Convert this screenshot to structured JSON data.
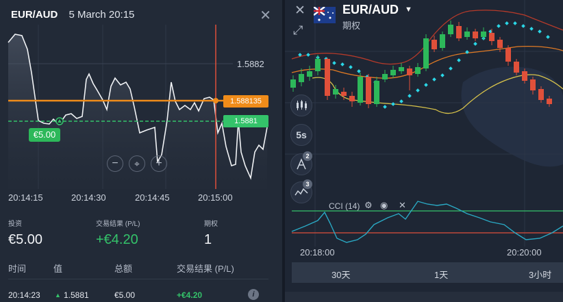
{
  "left_panel": {
    "asset": "EUR/AUD",
    "datetime": "5 March 20:15",
    "close_icon": "close-icon",
    "price_levels": {
      "top_label": "1.5882",
      "entry_price": "1.588135",
      "current_price": "1.5881"
    },
    "stake_marker": "€5.00",
    "x_axis": [
      "20:14:15",
      "20:14:30",
      "20:14:45",
      "20:15:00"
    ],
    "chart_controls": [
      "zoom-out-icon",
      "crosshair-icon",
      "zoom-in-icon"
    ],
    "info": {
      "investment_label": "投资",
      "investment_value": "€5.00",
      "pl_label": "交易结果 (P/L)",
      "pl_value": "+€4.20",
      "option_label": "期权",
      "option_value": "1"
    },
    "trades": {
      "headers": [
        "时间",
        "值",
        "总额",
        "交易结果 (P/L)"
      ],
      "rows": [
        {
          "time": "20:14:23",
          "value": "1.5881",
          "amount": "€5.00",
          "pl": "+€4.20"
        }
      ]
    }
  },
  "right_panel": {
    "asset": "EUR/AUD",
    "subtitle": "期权",
    "tools": [
      {
        "name": "chart-type-icon",
        "label": ""
      },
      {
        "name": "timeframe-button",
        "label": "5s"
      },
      {
        "name": "drawing-tools-icon",
        "label": "",
        "badge": "2"
      },
      {
        "name": "indicators-icon",
        "label": "",
        "badge": "3"
      }
    ],
    "indicator": "CCI (14)",
    "x_axis": [
      "20:18:00",
      "20:20:00"
    ],
    "periods": [
      "30天",
      "1天",
      "3小时"
    ]
  },
  "colors": {
    "up_candle": "#2db85a",
    "down_candle": "#e0503a",
    "entry_line": "#f08c1a",
    "current_line": "#34c36a",
    "expiry_line": "#e0503a",
    "sar_dots": "#2bd6e6",
    "cci_line": "#2aa9c4"
  }
}
